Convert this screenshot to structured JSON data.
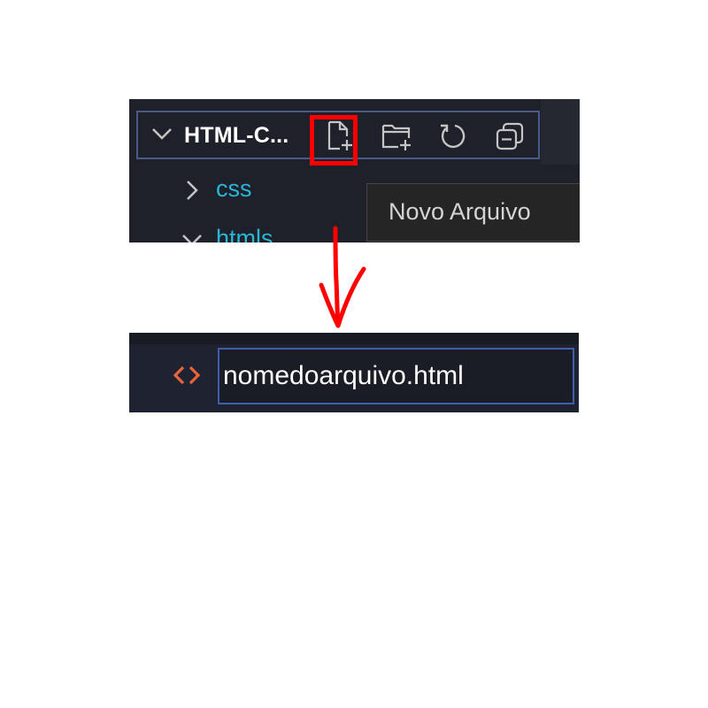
{
  "explorer": {
    "folder_title": "HTML-C...",
    "actions": [
      {
        "name": "new-file",
        "icon": "new-file-icon"
      },
      {
        "name": "new-folder",
        "icon": "new-folder-icon"
      },
      {
        "name": "refresh",
        "icon": "refresh-icon"
      },
      {
        "name": "collapse-all",
        "icon": "collapse-all-icon"
      }
    ],
    "tree": [
      {
        "label": "css",
        "state": "collapsed"
      },
      {
        "label": "htmls",
        "state": "expanded"
      }
    ],
    "tooltip": "Novo Arquivo"
  },
  "rename": {
    "icon": "html-file-icon",
    "value": "nomedoarquivo.html"
  },
  "colors": {
    "highlight": "#ff0000",
    "arrow": "#ff0000",
    "folder_text": "#29b6d8",
    "html_icon": "#e8643c",
    "focus_border": "#3f5fa8"
  }
}
